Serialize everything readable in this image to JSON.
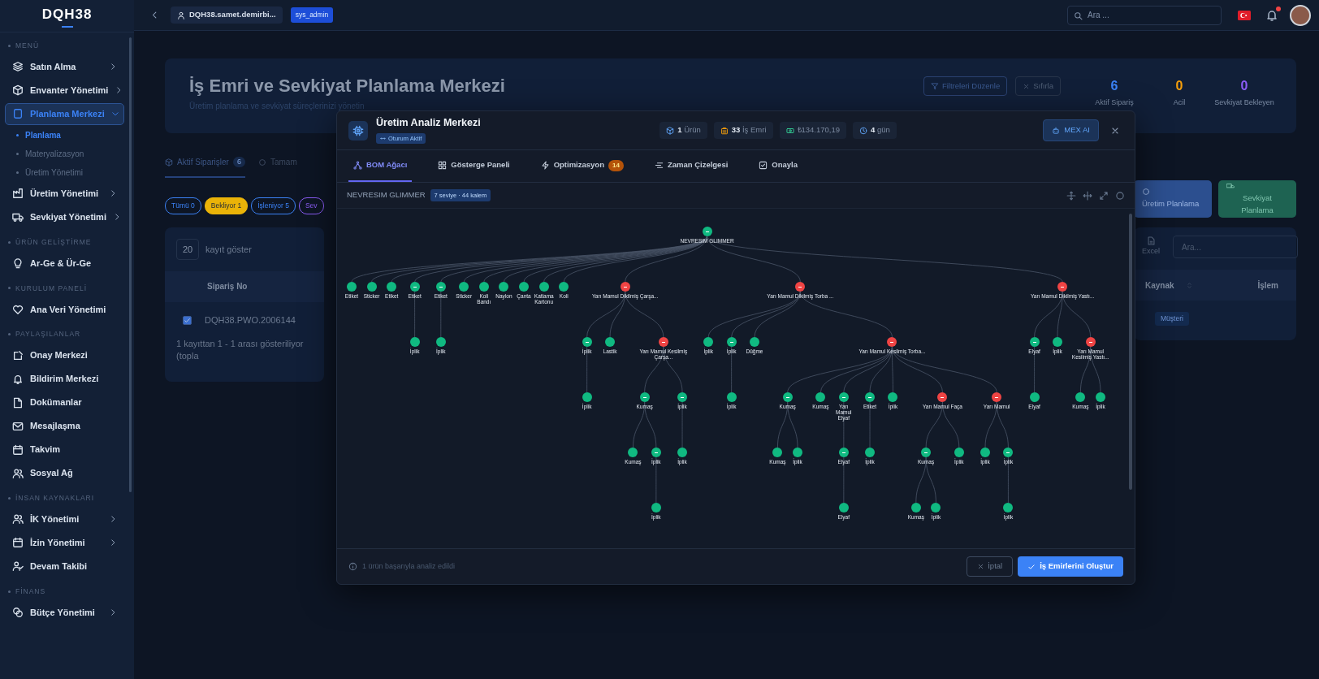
{
  "sidebar": {
    "logo": "DQH38",
    "sections": [
      {
        "title": "MENÜ",
        "items": [
          {
            "label": "Satın Alma",
            "has_submenu": true,
            "expanded": false,
            "selected": false
          },
          {
            "label": "Envanter Yönetimi",
            "has_submenu": true,
            "expanded": false,
            "selected": false
          },
          {
            "label": "Planlama Merkezi",
            "has_submenu": true,
            "expanded": true,
            "selected": true,
            "children": [
              {
                "label": "Planlama",
                "selected": true
              },
              {
                "label": "Materyalizasyon",
                "selected": false
              },
              {
                "label": "Üretim Yönetimi",
                "selected": false
              }
            ]
          },
          {
            "label": "Üretim Yönetimi",
            "has_submenu": true,
            "expanded": false,
            "selected": false
          },
          {
            "label": "Sevkiyat Yönetimi",
            "has_submenu": true,
            "expanded": false,
            "selected": false
          }
        ]
      },
      {
        "title": "ÜRÜN GELİŞTİRME",
        "items": [
          {
            "label": "Ar-Ge & Ür-Ge",
            "has_submenu": false,
            "selected": false
          }
        ]
      },
      {
        "title": "KURULUM PANELİ",
        "items": [
          {
            "label": "Ana Veri Yönetimi",
            "has_submenu": false,
            "selected": false
          }
        ]
      },
      {
        "title": "PAYLAŞILANLAR",
        "items": [
          {
            "label": "Onay Merkezi",
            "has_submenu": false,
            "selected": false
          },
          {
            "label": "Bildirim Merkezi",
            "has_submenu": false,
            "selected": false
          },
          {
            "label": "Dokümanlar",
            "has_submenu": false,
            "selected": false
          },
          {
            "label": "Mesajlaşma",
            "has_submenu": false,
            "selected": false
          },
          {
            "label": "Takvim",
            "has_submenu": false,
            "selected": false
          },
          {
            "label": "Sosyal Ağ",
            "has_submenu": false,
            "selected": false
          }
        ]
      },
      {
        "title": "İNSAN KAYNAKLARI",
        "items": [
          {
            "label": "İK Yönetimi",
            "has_submenu": true,
            "expanded": false,
            "selected": false
          },
          {
            "label": "İzin Yönetimi",
            "has_submenu": true,
            "expanded": false,
            "selected": false
          },
          {
            "label": "Devam Takibi",
            "has_submenu": false,
            "selected": false
          }
        ]
      },
      {
        "title": "FİNANS",
        "items": [
          {
            "label": "Bütçe Yönetimi",
            "has_submenu": true,
            "expanded": false,
            "selected": false
          }
        ]
      }
    ]
  },
  "topbar": {
    "user": "DQH38.samet.demirbi...",
    "role": "sys_admin",
    "search_placeholder": "Ara ...",
    "notification_dot": true
  },
  "page": {
    "title": "İş Emri ve Sevkiyat Planlama Merkezi",
    "subtitle": "Üretim planlama ve sevkiyat süreçlerinizi yönetin",
    "filter_button": "Filtreleri Düzenle",
    "reset_button": "Sıfırla",
    "stats": [
      {
        "value": "6",
        "label": "Aktif Sipariş",
        "color": "#3b82f6"
      },
      {
        "value": "0",
        "label": "Acil",
        "color": "#f59e0b"
      },
      {
        "value": "0",
        "label": "Sevkiyat Bekleyen",
        "color": "#8b5cf6"
      }
    ],
    "tabs": [
      {
        "label": "Aktif Siparişler",
        "count": "6",
        "selected": true
      },
      {
        "label": "Tamam",
        "selected": false
      }
    ],
    "filters": [
      {
        "label": "Tümü 0",
        "color": "#3b82f6",
        "selected": false
      },
      {
        "label": "Bekliyor 1",
        "color": "#eab308",
        "selected": true
      },
      {
        "label": "İşleniyor 5",
        "color": "#3b82f6",
        "selected": false
      },
      {
        "label": "Sev",
        "color": "#8b5cf6",
        "selected": false
      }
    ],
    "page_size": "20",
    "page_size_label": "kayıt göster",
    "column": "Sipariş No",
    "rows": [
      {
        "checked": true,
        "order_no": "DQH38.PWO.2006144",
        "source": "Müşteri"
      }
    ],
    "info": "1 kayıttan 1 - 1 arası gösteriliyor (topla",
    "action_buttons": [
      {
        "label": "Üretim Planlama",
        "kind": "primary"
      },
      {
        "label": "Sevkiyat Planlama",
        "kind": "success"
      }
    ],
    "export_label": "Excel",
    "search_placeholder": "Ara...",
    "right_columns": [
      "Kaynak",
      "İşlem"
    ]
  },
  "modal": {
    "title": "Üretim Analiz Merkezi",
    "session_badge": "Oturum Aktif",
    "stats": [
      "**1** Ürün",
      "**33** İş Emri",
      "₺134.170,19",
      "**4** gün"
    ],
    "ai_button": "MEX AI",
    "tabs": [
      {
        "label": "BOM Ağacı",
        "selected": true
      },
      {
        "label": "Gösterge Paneli",
        "selected": false
      },
      {
        "label": "Optimizasyon",
        "badge": "14",
        "selected": false
      },
      {
        "label": "Zaman Çizelgesi",
        "selected": false
      },
      {
        "label": "Onayla",
        "selected": false
      }
    ],
    "product": "NEVRESIM GLIMMER",
    "levels_badge": "7 seviye · 44 kalem",
    "bom_tree": {
      "label": "NEVRESIM GLIMMER",
      "color": "#10b981",
      "children": [
        {
          "label": "Etiket",
          "color": "#10b981"
        },
        {
          "label": "Sticker",
          "color": "#10b981"
        },
        {
          "label": "Etiket",
          "color": "#10b981"
        },
        {
          "label": "Etiket",
          "color": "#10b981",
          "children": [
            {
              "label": "İplik",
              "color": "#10b981"
            }
          ]
        },
        {
          "label": "Etiket",
          "color": "#10b981",
          "children": [
            {
              "label": "İplik",
              "color": "#10b981"
            }
          ]
        },
        {
          "label": "Sticker",
          "color": "#10b981"
        },
        {
          "label": "Koli Bandı",
          "color": "#10b981"
        },
        {
          "label": "Naylon",
          "color": "#10b981"
        },
        {
          "label": "Çanta",
          "color": "#10b981"
        },
        {
          "label": "Katlama Kartonu",
          "color": "#10b981"
        },
        {
          "label": "Koli",
          "color": "#10b981"
        },
        {
          "label": "Yarı Mamul Dikilmiş Çarşa...",
          "color": "#ef4444",
          "children": [
            {
              "label": "İplik",
              "color": "#10b981",
              "children": [
                {
                  "label": "İplik",
                  "color": "#10b981"
                }
              ]
            },
            {
              "label": "Lastik",
              "color": "#10b981"
            },
            {
              "label": "Yarı Mamul Kesilmiş Çarşa...",
              "color": "#ef4444",
              "children": [
                {
                  "label": "Kumaş",
                  "color": "#10b981",
                  "children": [
                    {
                      "label": "Kumaş",
                      "color": "#10b981"
                    },
                    {
                      "label": "İplik",
                      "color": "#10b981",
                      "children": [
                        {
                          "label": "İplik",
                          "color": "#10b981"
                        }
                      ]
                    }
                  ]
                },
                {
                  "label": "İplik",
                  "color": "#10b981",
                  "children": [
                    {
                      "label": "İplik",
                      "color": "#10b981"
                    }
                  ]
                }
              ]
            }
          ]
        },
        {
          "label": "Yarı Mamul Dikilmiş Torba ...",
          "color": "#ef4444",
          "children": [
            {
              "label": "İplik",
              "color": "#10b981"
            },
            {
              "label": "İplik",
              "color": "#10b981",
              "children": [
                {
                  "label": "İplik",
                  "color": "#10b981"
                }
              ]
            },
            {
              "label": "Düğme",
              "color": "#10b981"
            },
            {
              "label": "Yarı Mamul Kesilmiş Torba...",
              "color": "#ef4444",
              "children": [
                {
                  "label": "Kumaş",
                  "color": "#10b981",
                  "children": [
                    {
                      "label": "Kumaş",
                      "color": "#10b981"
                    },
                    {
                      "label": "İplik",
                      "color": "#10b981"
                    }
                  ]
                },
                {
                  "label": "Kumaş",
                  "color": "#10b981"
                },
                {
                  "label": "Yarı Mamul Elyaf",
                  "color": "#10b981",
                  "children": [
                    {
                      "label": "Elyaf",
                      "color": "#10b981",
                      "children": [
                        {
                          "label": "Elyaf",
                          "color": "#10b981"
                        }
                      ]
                    }
                  ]
                },
                {
                  "label": "Etiket",
                  "color": "#10b981",
                  "children": [
                    {
                      "label": "İplik",
                      "color": "#10b981"
                    }
                  ]
                },
                {
                  "label": "İplik",
                  "color": "#10b981"
                },
                {
                  "label": "Yarı Mamul Faça",
                  "color": "#ef4444",
                  "children": [
                    {
                      "label": "Kumaş",
                      "color": "#10b981",
                      "children": [
                        {
                          "label": "Kumaş",
                          "color": "#10b981"
                        },
                        {
                          "label": "İplik",
                          "color": "#10b981"
                        }
                      ]
                    },
                    {
                      "label": "İplik",
                      "color": "#10b981"
                    }
                  ]
                },
                {
                  "label": "Yarı Mamul",
                  "color": "#ef4444",
                  "children": [
                    {
                      "label": "İplik",
                      "color": "#10b981"
                    },
                    {
                      "label": "İplik",
                      "color": "#10b981",
                      "children": [
                        {
                          "label": "İplik",
                          "color": "#10b981"
                        }
                      ]
                    }
                  ]
                }
              ]
            }
          ]
        },
        {
          "label": "Yarı Mamul Dikilmiş Yastı...",
          "color": "#ef4444",
          "children": [
            {
              "label": "Elyaf",
              "color": "#10b981",
              "children": [
                {
                  "label": "Elyaf",
                  "color": "#10b981"
                }
              ]
            },
            {
              "label": "İplik",
              "color": "#10b981"
            },
            {
              "label": "Yarı Mamul Kesilmiş Yastı...",
              "color": "#ef4444",
              "children": [
                {
                  "label": "Kumaş",
                  "color": "#10b981"
                },
                {
                  "label": "İplik",
                  "color": "#10b981"
                }
              ]
            }
          ]
        }
      ]
    },
    "footer_message": "1 ürün başarıyla analiz edildi",
    "cancel_button": "İptal",
    "confirm_button": "İş Emirlerini Oluştur"
  }
}
